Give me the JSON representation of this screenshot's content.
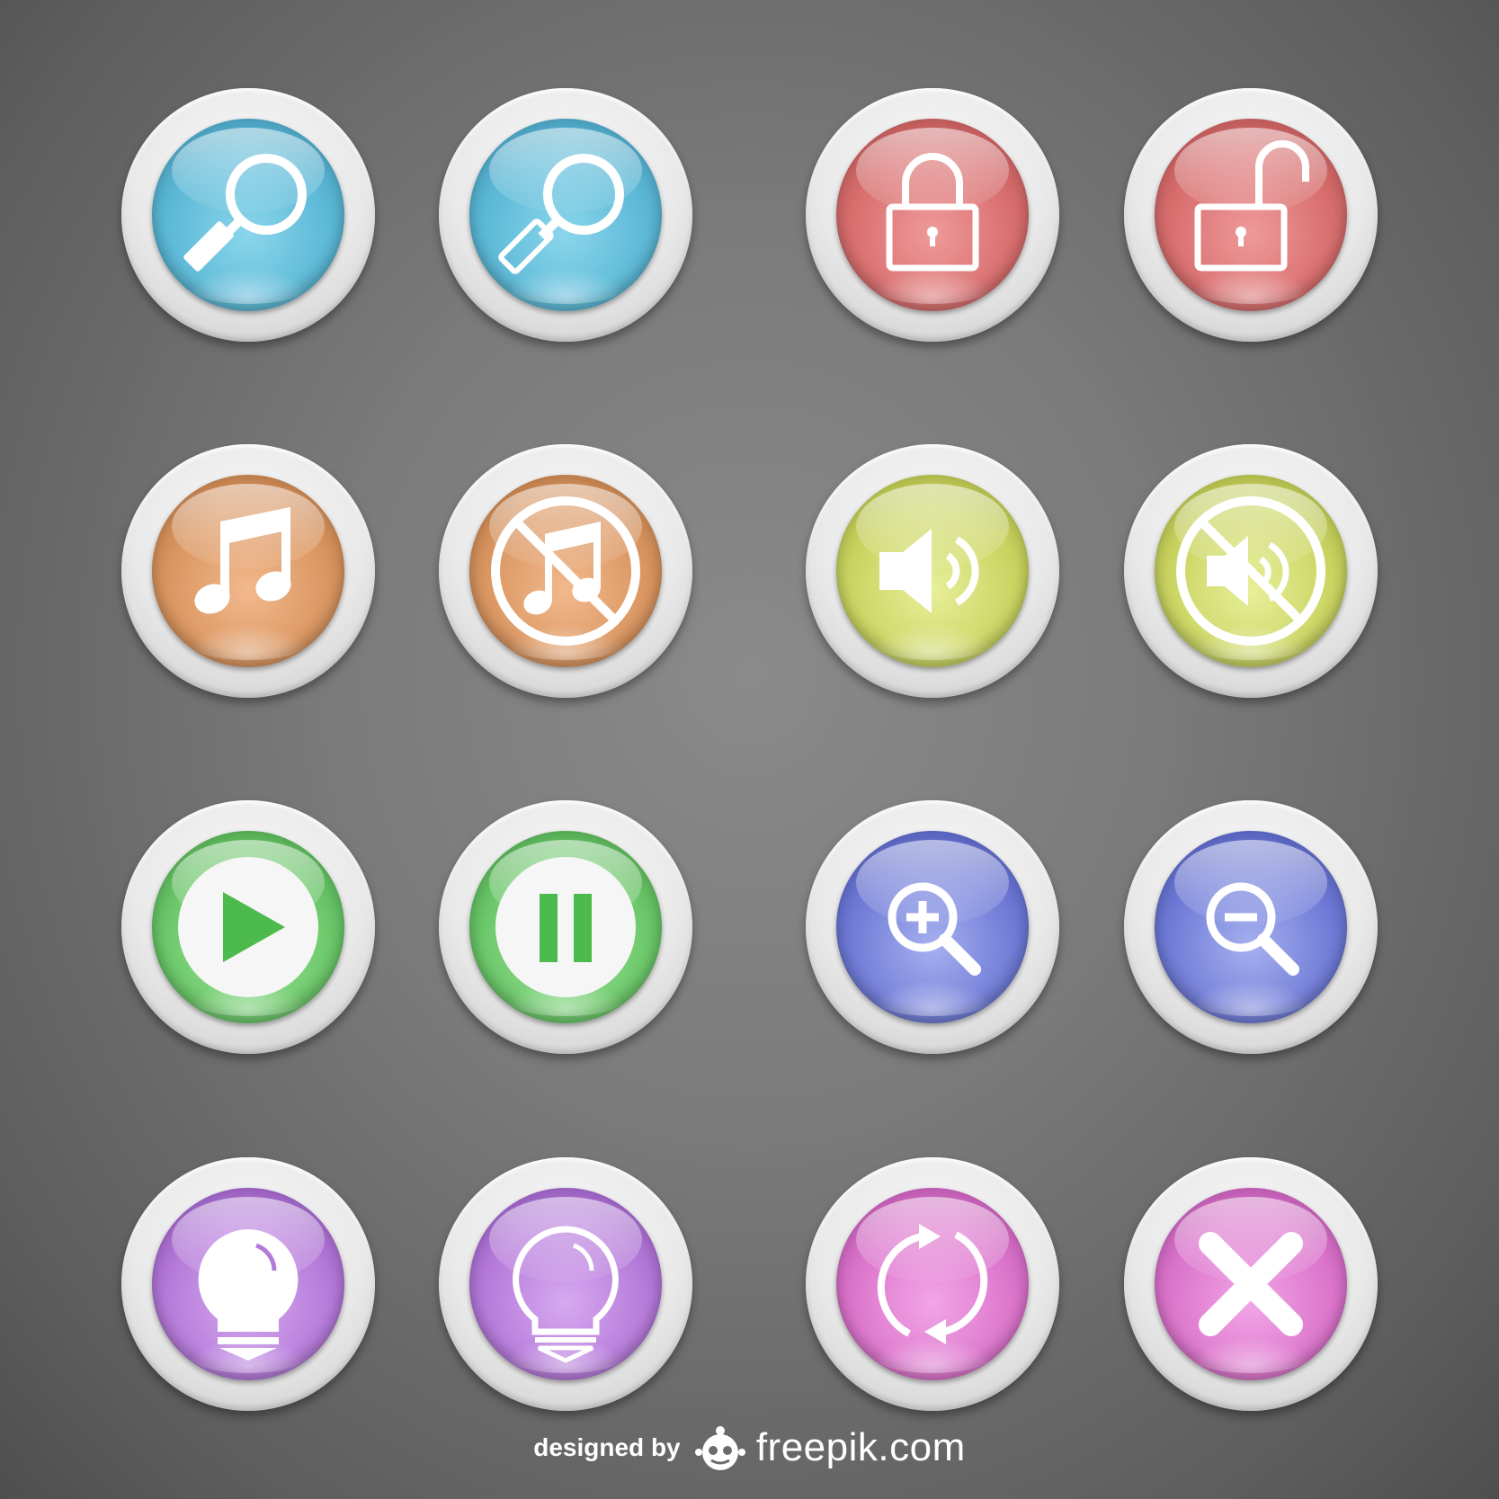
{
  "buttons": [
    {
      "name": "search-button",
      "icon": "search-icon",
      "color": "#5bb8d6"
    },
    {
      "name": "search-alt-button",
      "icon": "search-icon",
      "color": "#5bb8d6"
    },
    {
      "name": "lock-button",
      "icon": "lock-icon",
      "color": "#d86e6e"
    },
    {
      "name": "unlock-button",
      "icon": "unlock-icon",
      "color": "#d86e6e"
    },
    {
      "name": "music-button",
      "icon": "music-note-icon",
      "color": "#d99560"
    },
    {
      "name": "no-music-button",
      "icon": "music-off-icon",
      "color": "#d99560"
    },
    {
      "name": "volume-button",
      "icon": "speaker-icon",
      "color": "#c9d461"
    },
    {
      "name": "mute-button",
      "icon": "speaker-off-icon",
      "color": "#c9d461"
    },
    {
      "name": "play-button",
      "icon": "play-icon",
      "color": "#6cc86a"
    },
    {
      "name": "pause-button",
      "icon": "pause-icon",
      "color": "#6cc86a"
    },
    {
      "name": "zoom-in-button",
      "icon": "zoom-in-icon",
      "color": "#6f7bd6"
    },
    {
      "name": "zoom-out-button",
      "icon": "zoom-out-icon",
      "color": "#6f7bd6"
    },
    {
      "name": "idea-button",
      "icon": "lightbulb-icon",
      "color": "#b57ad9"
    },
    {
      "name": "idea-outline-button",
      "icon": "lightbulb-outline-icon",
      "color": "#b57ad9"
    },
    {
      "name": "refresh-button",
      "icon": "refresh-icon",
      "color": "#db74cb"
    },
    {
      "name": "close-button",
      "icon": "close-icon",
      "color": "#db74cb"
    }
  ],
  "credit": {
    "designed_by": "designed by",
    "brand": "freepik.com"
  }
}
